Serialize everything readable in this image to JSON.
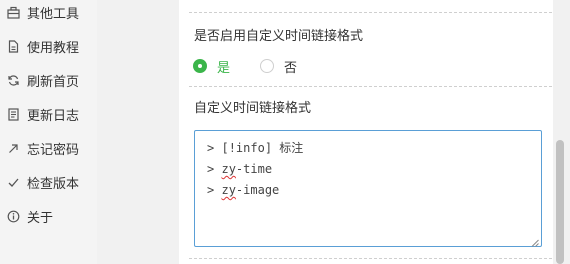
{
  "sidebar": {
    "items": [
      {
        "label": "其他工具",
        "icon": "toolbox-icon"
      },
      {
        "label": "使用教程",
        "icon": "document-icon"
      },
      {
        "label": "刷新首页",
        "icon": "refresh-icon"
      },
      {
        "label": "更新日志",
        "icon": "log-icon"
      },
      {
        "label": "忘记密码",
        "icon": "arrow-up-right-icon"
      },
      {
        "label": "检查版本",
        "icon": "checkmark-icon"
      },
      {
        "label": "关于",
        "icon": "info-icon"
      }
    ]
  },
  "settings": {
    "enable_custom_format_label": "是否启用自定义时间链接格式",
    "radio_yes": "是",
    "radio_no": "否",
    "selected": "是",
    "custom_format_label": "自定义时间链接格式",
    "textarea_prefix": ">",
    "textarea_lines": [
      {
        "text": "[!info] 标注"
      },
      {
        "text": "zy-time",
        "misspelled": "zy"
      },
      {
        "text": "zy-image",
        "misspelled": "zy"
      }
    ]
  },
  "colors": {
    "accent_green": "#3bb54a",
    "focus_blue": "#5a9fd6"
  }
}
